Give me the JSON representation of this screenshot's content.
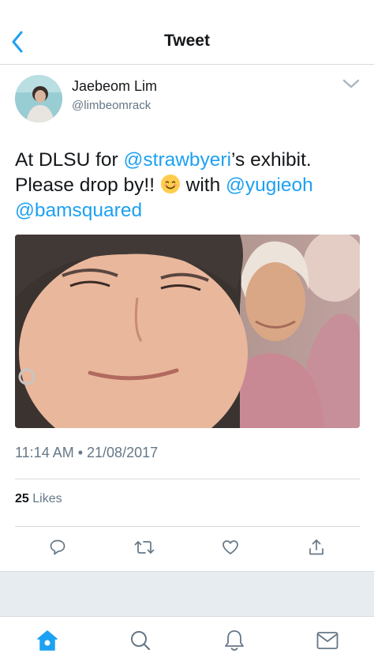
{
  "header": {
    "title": "Tweet",
    "back_icon": "chevron-left-icon"
  },
  "author": {
    "name": "Jaebeom Lim",
    "handle": "@limbeomrack"
  },
  "tweet": {
    "text_part1": "At DLSU for ",
    "mention1": "@strawbyeri",
    "text_part2": "’s exhibit.",
    "text_part3": "Please drop by!! ",
    "emoji": "smiling-face-emoji",
    "text_part4": " with ",
    "mention2": "@yugieoh",
    "mention3": "@bamsquared",
    "timestamp": "11:14 AM • 21/08/2017"
  },
  "stats": {
    "likes_count": "25",
    "likes_label": "Likes"
  },
  "actions": [
    "reply-icon",
    "retweet-icon",
    "like-icon",
    "share-icon"
  ],
  "tabs": [
    "home-icon",
    "search-icon",
    "notifications-icon",
    "messages-icon"
  ],
  "colors": {
    "accent": "#1da1f2",
    "text": "#14171a",
    "secondary": "#657786",
    "divider": "#d6dbe0",
    "background_gray": "#e6ecf0"
  }
}
